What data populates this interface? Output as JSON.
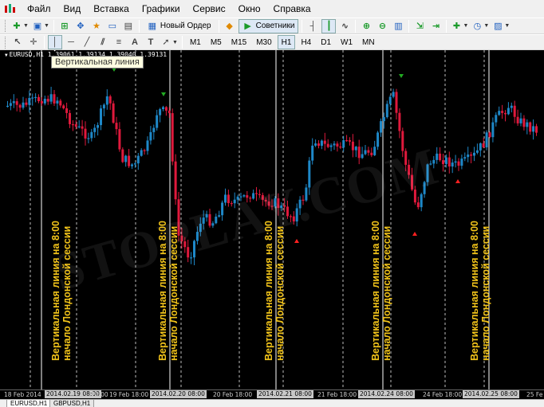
{
  "menu": [
    "Файл",
    "Вид",
    "Вставка",
    "Графики",
    "Сервис",
    "Окно",
    "Справка"
  ],
  "toolbar1": {
    "new_order_label": "Новый Ордер",
    "experts_label": "Советники"
  },
  "toolbar2": {
    "text_tool": "A",
    "timeframes": [
      "M1",
      "M5",
      "M15",
      "M30",
      "H1",
      "H4",
      "D1",
      "W1",
      "MN"
    ]
  },
  "chart": {
    "header": "EURUSD,H1  1.39061 1.39134 1.39040 1.39131",
    "tooltip": "Вертикальная линия",
    "watermark": "STOPLAY.COM",
    "annotation_line1": "Вертикальная линия на 8:00",
    "annotation_line2": "начало Лондонской сессии",
    "colors": {
      "bull": "#1e88c8",
      "bear": "#e0193c",
      "annotation": "#f2c41a",
      "up_arrow": "#ff2020",
      "down_arrow": "#22aa22"
    }
  },
  "time_axis": [
    {
      "label": "18 Feb 2014",
      "hl": false
    },
    {
      "label": "2014.02.19 08:00",
      "hl": true
    },
    {
      "label": "10:00",
      "hl": false
    },
    {
      "label": "19 Feb 18:00",
      "hl": false
    },
    {
      "label": "2014.02.20 08:00",
      "hl": true
    },
    {
      "label": "20 Feb 18:00",
      "hl": false
    },
    {
      "label": "2014.02.21 08:00",
      "hl": true
    },
    {
      "label": "21 Feb 18:00",
      "hl": false
    },
    {
      "label": "2014.02.24 08:00",
      "hl": true
    },
    {
      "label": "24 Feb 18:00",
      "hl": false
    },
    {
      "label": "2014.02.25 08:00",
      "hl": true
    },
    {
      "label": "25 Fe",
      "hl": false
    }
  ],
  "tabs": [
    "EURUSD,H1",
    "GBPUSD,H1"
  ]
}
